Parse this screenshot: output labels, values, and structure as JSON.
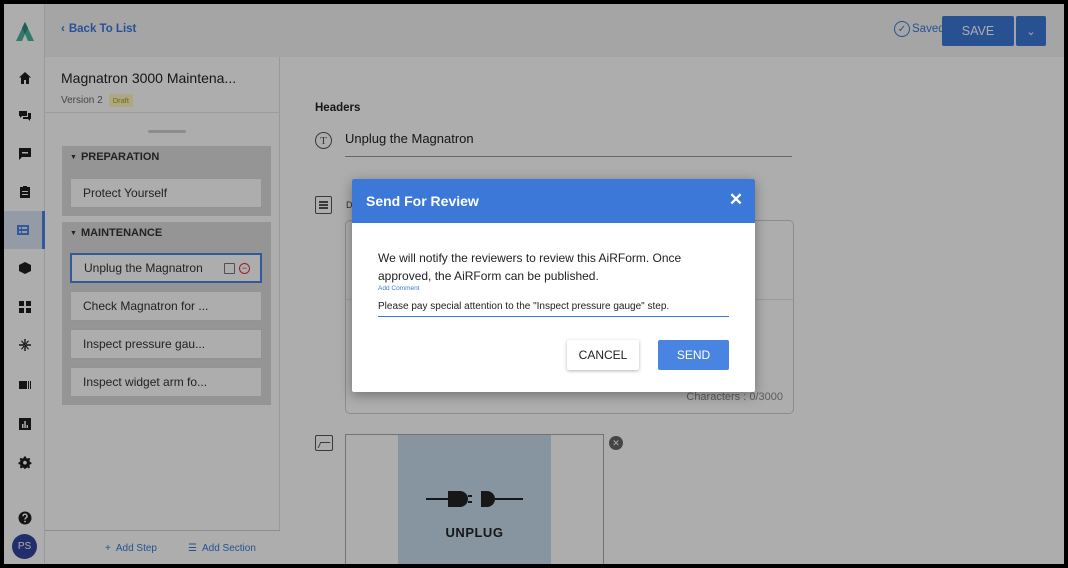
{
  "topbar": {
    "back_label": "Back To List",
    "saved_label": "Saved",
    "save_label": "SAVE"
  },
  "rail": {
    "items": [
      "home-icon",
      "chat-icon",
      "comment-icon",
      "clipboard-icon",
      "form-icon",
      "box-icon",
      "widgets-icon",
      "sparkle-icon",
      "id-card-icon",
      "report-icon",
      "gear-icon",
      "help-icon"
    ],
    "active_item": "form-icon",
    "avatar_initials": "PS"
  },
  "panel": {
    "doc_title": "Magnatron 3000 Maintena...",
    "version": "Version 2",
    "status_badge": "Draft",
    "sections": [
      {
        "name": "PREPARATION",
        "steps": [
          "Protect Yourself"
        ]
      },
      {
        "name": "MAINTENANCE",
        "steps": [
          "Unplug the Magnatron",
          "Check Magnatron for ...",
          "Inspect pressure gau...",
          "Inspect widget arm fo..."
        ]
      }
    ],
    "add_step": "Add Step",
    "add_section": "Add Section"
  },
  "main": {
    "headers_label": "Headers",
    "header_value": "Unplug the Magnatron",
    "description_label": "D",
    "char_count": "Characters : 0/3000",
    "image_caption": "UNPLUG"
  },
  "modal": {
    "title": "Send For Review",
    "body": "We will notify the reviewers to review this AiRForm. Once approved, the AiRForm can be published.",
    "comment_label": "Add Comment",
    "comment_value": "Please pay special attention to the \"Inspect pressure gauge\" step.",
    "cancel_label": "CANCEL",
    "send_label": "SEND"
  },
  "colors": {
    "accent": "#3b78d8",
    "draft_badge_bg": "#fff6c2",
    "draft_badge_text": "#b59600",
    "image_bg": "#c6dcec"
  }
}
